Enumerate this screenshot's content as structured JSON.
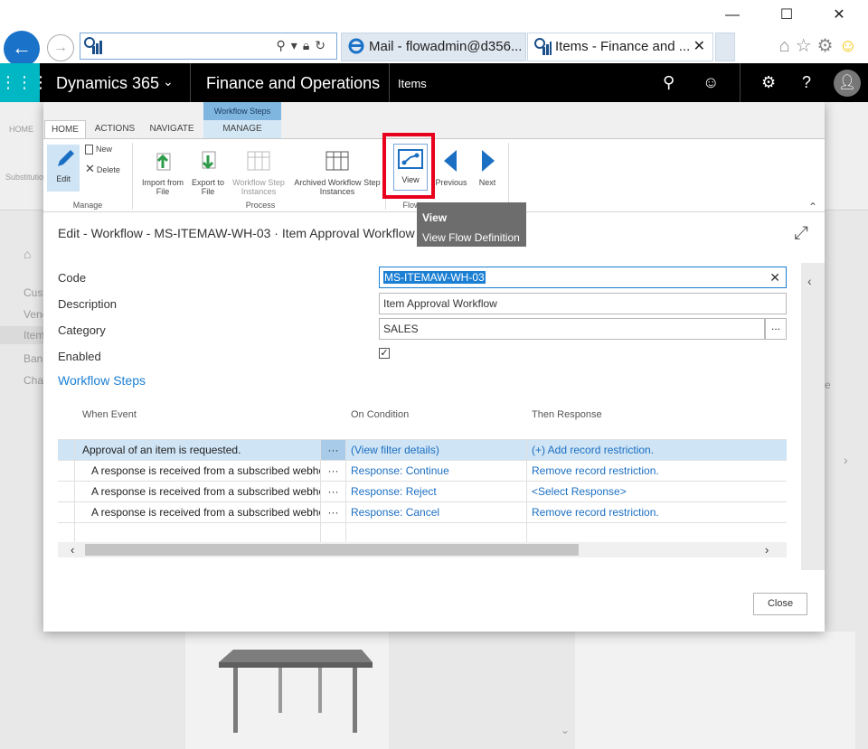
{
  "browser": {
    "window_controls": {
      "minimize": "—",
      "maximize": "☐",
      "close": "✕"
    },
    "tabs": [
      {
        "label": "Mail - flowadmin@d356...",
        "icon": "outlook-icon"
      },
      {
        "label": "Items - Finance and ...",
        "icon": "d365-icon",
        "close": "✕"
      }
    ]
  },
  "app": {
    "product": "Dynamics 365",
    "module": "Finance and Operations",
    "breadcrumb": "Items"
  },
  "background": {
    "ribbon_home": "HOME",
    "substitution": "Substitution",
    "nav_items": [
      "Cust",
      "Vend",
      "Item",
      "Bank",
      "Char"
    ],
    "trailing_e": "e"
  },
  "ribbon": {
    "tabs": {
      "home": "HOME",
      "actions": "ACTIONS",
      "navigate": "NAVIGATE"
    },
    "context_group": "Workflow Steps",
    "context_tab": "MANAGE",
    "buttons": {
      "edit": "Edit",
      "new": "New",
      "delete": "Delete",
      "import_from_file": [
        "Import from",
        "File"
      ],
      "export_to_file": [
        "Export to",
        "File"
      ],
      "workflow_step_instances": [
        "Workflow Step",
        "Instances"
      ],
      "archived_workflow_step_instances": [
        "Archived Workflow Step",
        "Instances"
      ],
      "view": "View",
      "previous": "Previous",
      "next": "Next"
    },
    "groups": {
      "manage": "Manage",
      "process": "Process",
      "flow": "Flow"
    }
  },
  "tooltip": {
    "title": "View",
    "description": "View Flow Definition"
  },
  "dialog": {
    "title": "Edit - Workflow - MS-ITEMAW-WH-03 · Item Approval Workflow",
    "fields": {
      "code": {
        "label": "Code",
        "value": "MS-ITEMAW-WH-03"
      },
      "description": {
        "label": "Description",
        "value": "Item Approval Workflow"
      },
      "category": {
        "label": "Category",
        "value": "SALES"
      },
      "enabled": {
        "label": "Enabled",
        "checked": true
      }
    },
    "lookup_button": "...",
    "section_title": "Workflow Steps",
    "grid": {
      "headers": [
        "When Event",
        "On Condition",
        "Then Response"
      ],
      "rows": [
        {
          "event": "Approval of an item is requested.",
          "condition": "(View filter details)",
          "response": "(+) Add record restriction."
        },
        {
          "event": "A response is received from a subscribed webhook",
          "condition": "Response: Continue",
          "response": "Remove record restriction."
        },
        {
          "event": "A response is received from a subscribed webhook",
          "condition": "Response: Reject",
          "response": "<Select Response>"
        },
        {
          "event": "A response is received from a subscribed webhook",
          "condition": "Response: Cancel",
          "response": "Remove record restriction."
        }
      ],
      "dots": "···"
    },
    "close_label": "Close"
  }
}
